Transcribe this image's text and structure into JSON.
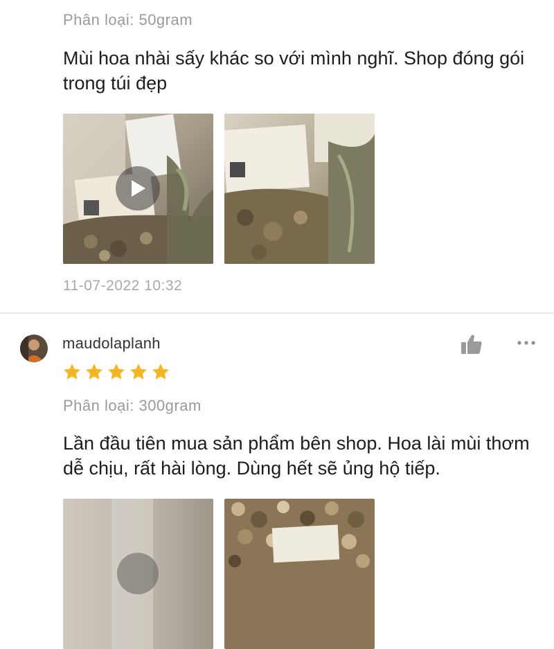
{
  "reviews": [
    {
      "variant": "Phân loại: 50gram",
      "comment": "Mùi hoa nhài sấy khác so với mình nghĩ. Shop đóng gói trong túi đẹp",
      "timestamp": "11-07-2022 10:32",
      "media": [
        "video",
        "image"
      ]
    },
    {
      "username": "maudolaplanh",
      "rating": 5,
      "variant": "Phân loại: 300gram",
      "comment": "Lần đầu tiên mua sản phẩm bên shop. Hoa lài mùi thơm dễ chịu, rất hài lòng. Dùng hết sẽ ủng hộ tiếp.",
      "media": [
        "video",
        "image"
      ]
    }
  ],
  "icons": {
    "like": "thumbs-up-icon",
    "more": "more-dots-icon",
    "star": "star-icon",
    "play": "play-icon"
  },
  "colors": {
    "star": "#f5b623",
    "muted_text": "#9a9a9a",
    "icon_gray": "#9b9b9b"
  }
}
